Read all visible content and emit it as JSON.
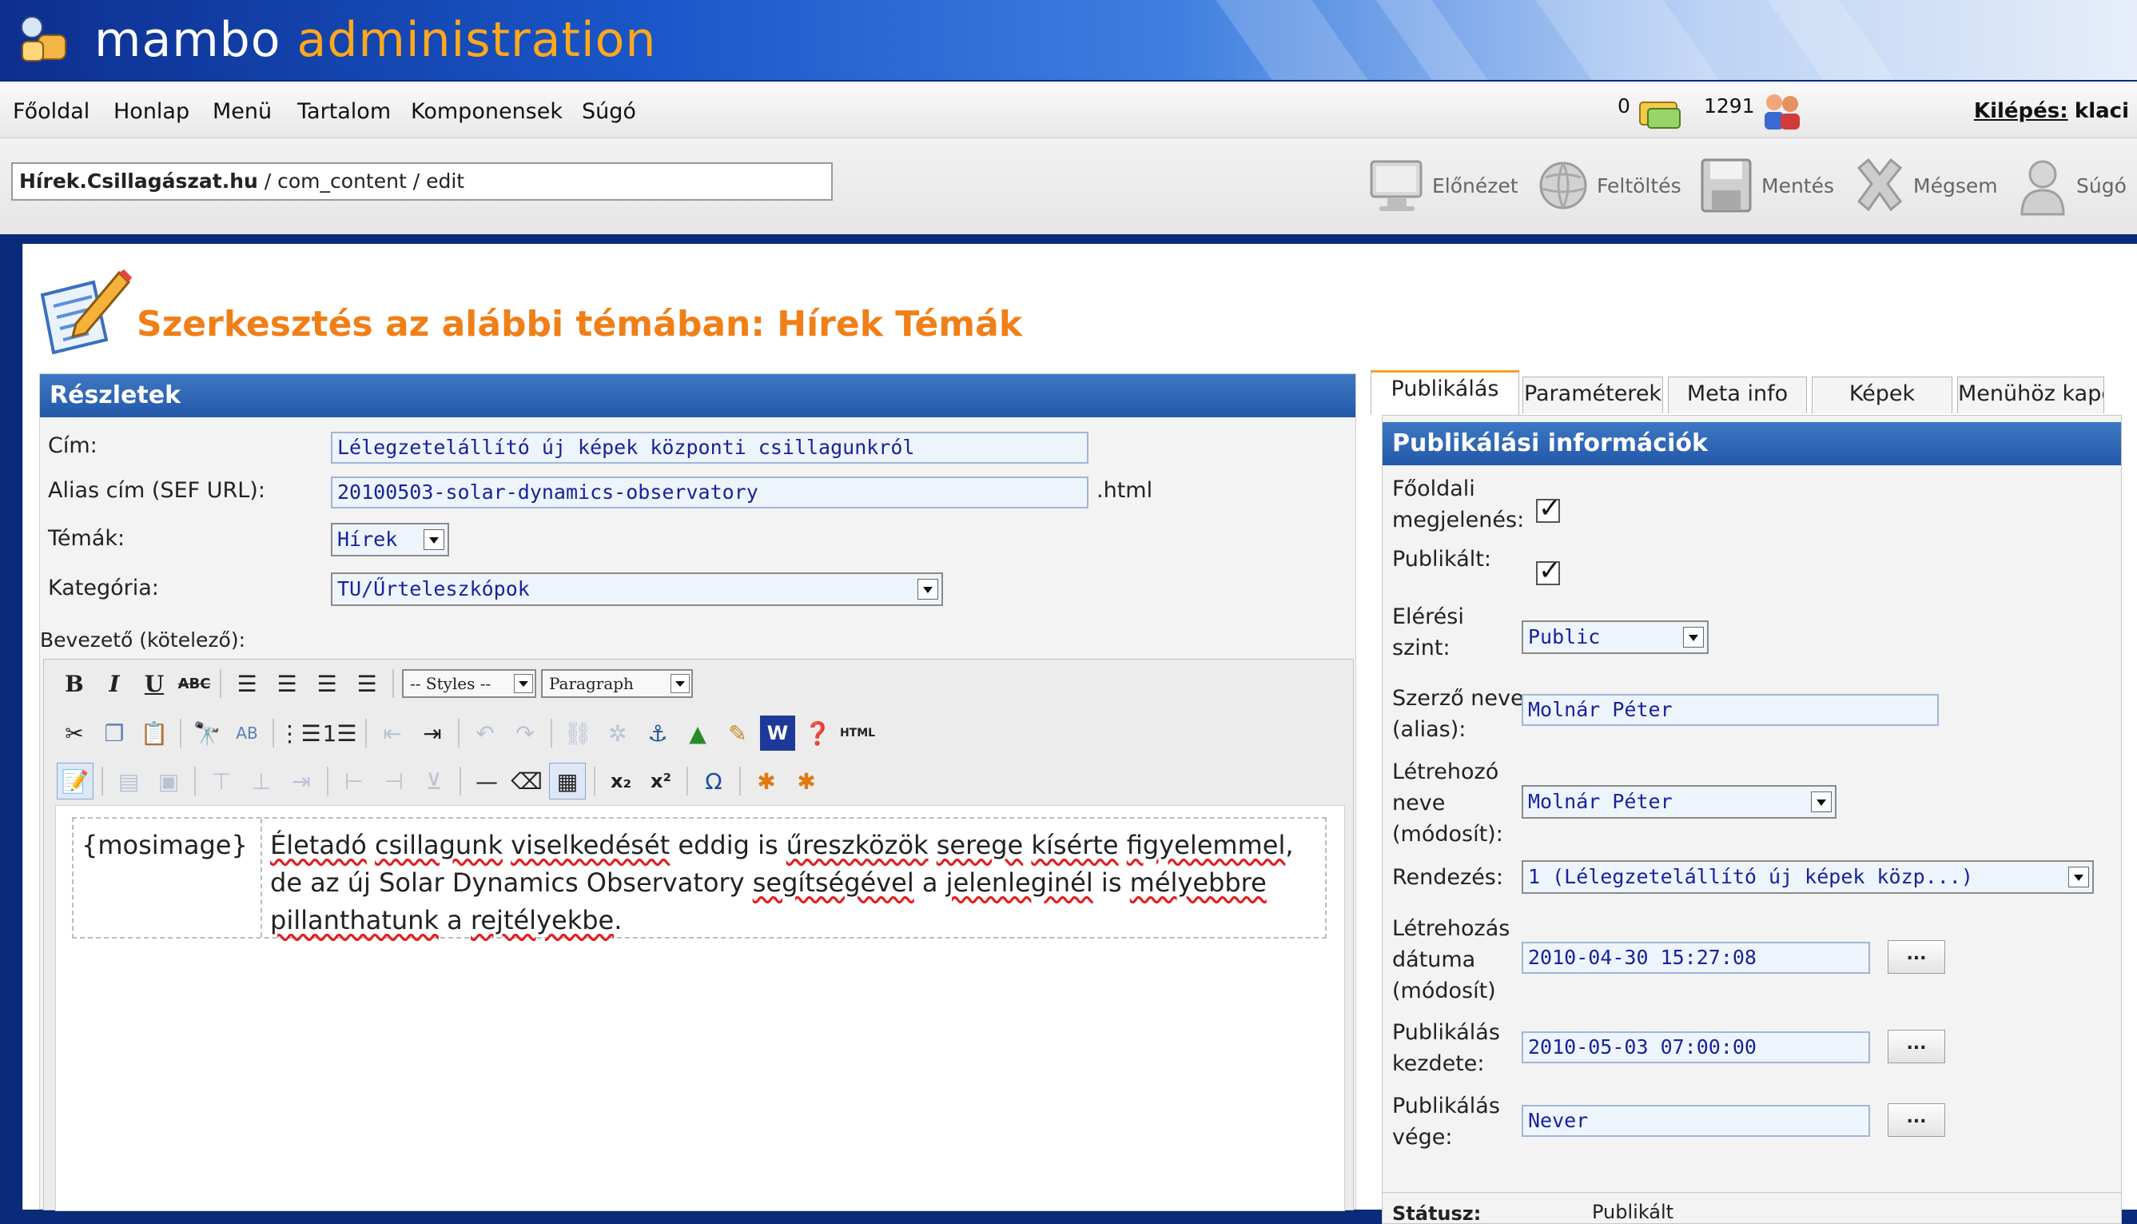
{
  "app": {
    "logo_word1": "mambo",
    "logo_word2": "administration",
    "colors": {
      "header_blue": "#1a56c8",
      "accent_orange": "#f07f18",
      "section_blue": "#2358a8"
    }
  },
  "menu": {
    "items": [
      "Főoldal",
      "Honlap",
      "Menü",
      "Tartalom",
      "Komponensek",
      "Súgó"
    ],
    "messages_count": "0",
    "users_count": "1291",
    "logout_label": "Kilépés:",
    "username": "klaci"
  },
  "path": {
    "site": "Hírek.Csillagászat.hu",
    "rest": " / com_content / edit"
  },
  "toolbar": {
    "preview": "Előnézet",
    "upload": "Feltöltés",
    "save": "Mentés",
    "cancel": "Mégsem",
    "help": "Súgó"
  },
  "page_title": "Szerkesztés az alábbi témában: Hírek Témák",
  "details": {
    "header": "Részletek",
    "title_label": "Cím:",
    "title_value": "Lélegzetelállító új képek központi csillagunkról",
    "alias_label": "Alias cím (SEF URL):",
    "alias_value": "20100503-solar-dynamics-observatory",
    "alias_suffix": ".html",
    "section_label": "Témák:",
    "section_value": "Hírek",
    "category_label": "Kategória:",
    "category_value": "TU/Űrteleszkópok",
    "intro_label": "Bevezető (kötelező):"
  },
  "editor": {
    "styles_select": "-- Styles --",
    "format_select": "Paragraph",
    "mosimage": "{mosimage}",
    "text_words": [
      "Életadó",
      " ",
      "csillagunk",
      " ",
      "viselkedését",
      " eddig is ",
      "űreszközök",
      " ",
      "serege",
      " ",
      "kísérte",
      " ",
      "figyelemmel",
      ", de az új Solar Dynamics Observatory ",
      "segítségével",
      " a ",
      "jelenleginél",
      " is ",
      "mélyebbre",
      " ",
      "pillanthatunk",
      " a ",
      "rejtélyekbe",
      "."
    ]
  },
  "tabs": [
    "Publikálás",
    "Paraméterek",
    "Meta info",
    "Képek",
    "Menühöz kapc"
  ],
  "publish": {
    "header": "Publikálási információk",
    "frontpage_label_1": "Főoldali",
    "frontpage_label_2": "megjelenés:",
    "published_label": "Publikált:",
    "access_label_1": "Elérési",
    "access_label_2": "szint:",
    "access_value": "Public",
    "author_alias_label_1": "Szerző neve",
    "author_alias_label_2": "(alias):",
    "author_alias_value": "Molnár Péter",
    "creator_label_1": "Létrehozó",
    "creator_label_2": "neve",
    "creator_label_3": "(módosít):",
    "creator_value": "Molnár Péter",
    "ordering_label": "Rendezés:",
    "ordering_value": "1 (Lélegzetelállító új képek közp...)",
    "created_label_1": "Létrehozás",
    "created_label_2": "dátuma",
    "created_label_3": "(módosít)",
    "created_value": "2010-04-30 15:27:08",
    "publish_up_label_1": "Publikálás",
    "publish_up_label_2": "kezdete:",
    "publish_up_value": "2010-05-03 07:00:00",
    "publish_down_label_1": "Publikálás",
    "publish_down_label_2": "vége:",
    "publish_down_value": "Never",
    "dots": "...",
    "status_label": "Státusz:",
    "status_value": "Publikált"
  }
}
